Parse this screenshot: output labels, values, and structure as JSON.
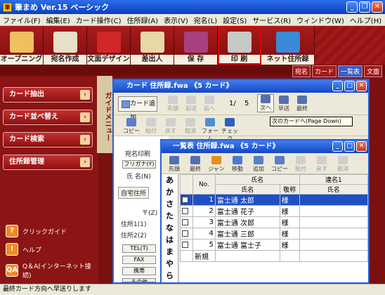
{
  "app": {
    "title": "筆まめ Ver.15 ベーシック",
    "icon": "筆"
  },
  "menu": [
    "ファイル(F)",
    "編集(E)",
    "カード操作(C)",
    "住所録(A)",
    "表示(V)",
    "宛名(L)",
    "設定(S)",
    "サービス(R)",
    "ウィンドウ(W)",
    "ヘルプ(H)"
  ],
  "toolbar": [
    {
      "label": "オープニング",
      "icon": "opening-icon",
      "color": "#f0c060"
    },
    {
      "label": "宛名作成",
      "icon": "address-create-icon",
      "color": "#e8e0c8"
    },
    {
      "label": "文面デザイン",
      "icon": "design-icon",
      "color": "#d02828"
    },
    {
      "label": "差出人",
      "icon": "sender-icon",
      "color": "#e8d8a8"
    },
    {
      "label": "保 存",
      "icon": "save-icon",
      "color": "#a84080"
    },
    {
      "label": "印 刷",
      "icon": "printer-icon",
      "color": "#c8c8c8",
      "active": true
    },
    {
      "label": "ネット住所録",
      "icon": "globe-icon",
      "color": "#3a8ad8"
    }
  ],
  "mode_tabs": [
    "宛名",
    "カード",
    "一覧表",
    "文面"
  ],
  "sidebar": {
    "buttons": [
      "カード抽出",
      "カード並べ替え",
      "カード検索",
      "住所録管理"
    ],
    "guide_label": "ガイドメニュー",
    "help_items": [
      {
        "label": "クリックガイド",
        "icon": "?"
      },
      {
        "label": "ヘルプ",
        "icon": "!"
      },
      {
        "label": "Q＆A(インターネット接続)",
        "icon": "QA"
      }
    ]
  },
  "card_window": {
    "title": "カード  住所録.fwa    《5 カード》",
    "add_button": "カード追加",
    "nav": [
      "先頭",
      "前送",
      "前へ"
    ],
    "position": "1/",
    "total": "5",
    "nav_next": [
      "次へ",
      "早送",
      "最終"
    ],
    "tools": [
      "コピー",
      "貼付",
      "戻す",
      "取消",
      "フォーム",
      "チェック"
    ],
    "tooltip": "次のカードへ(Page Down)",
    "form_labels": {
      "print": "宛名印刷",
      "furigana": "フリガナ(Y)",
      "name": "氏 名(N)",
      "home_tab": "自宅住所",
      "zip": "〒(Z)",
      "addr1": "住所1(1)",
      "addr2": "住所2(2)",
      "tel": "TEL(T)",
      "fax": "FAX",
      "mobile": "携帯",
      "other": "その他"
    }
  },
  "list_window": {
    "title": "一覧表  住所録.fwa    《5 カード》",
    "tools": [
      "先頭",
      "最終",
      "ジャンプ",
      "移動",
      "追加",
      "コピー",
      "貼付",
      "戻す",
      "取消"
    ],
    "kana_index": [
      "あ",
      "か",
      "さ",
      "た",
      "な",
      "は",
      "ま",
      "や",
      "ら"
    ],
    "table_headers": {
      "no": "No.",
      "name_group": "氏名",
      "name": "氏名",
      "honorific": "敬称",
      "joint_group": "連名1",
      "joint_name": "氏名"
    },
    "rows": [
      {
        "no": "1",
        "name": "富士通  太郎",
        "honorific": "様",
        "selected": true
      },
      {
        "no": "2",
        "name": "富士通  花子",
        "honorific": "様"
      },
      {
        "no": "3",
        "name": "富士通  次郎",
        "honorific": "様"
      },
      {
        "no": "4",
        "name": "富士通  三郎",
        "honorific": "様"
      },
      {
        "no": "5",
        "name": "富士通  富士子",
        "honorific": "様"
      }
    ],
    "new_row": "新規"
  },
  "status_bar": "最終カード方向へ早送りします"
}
